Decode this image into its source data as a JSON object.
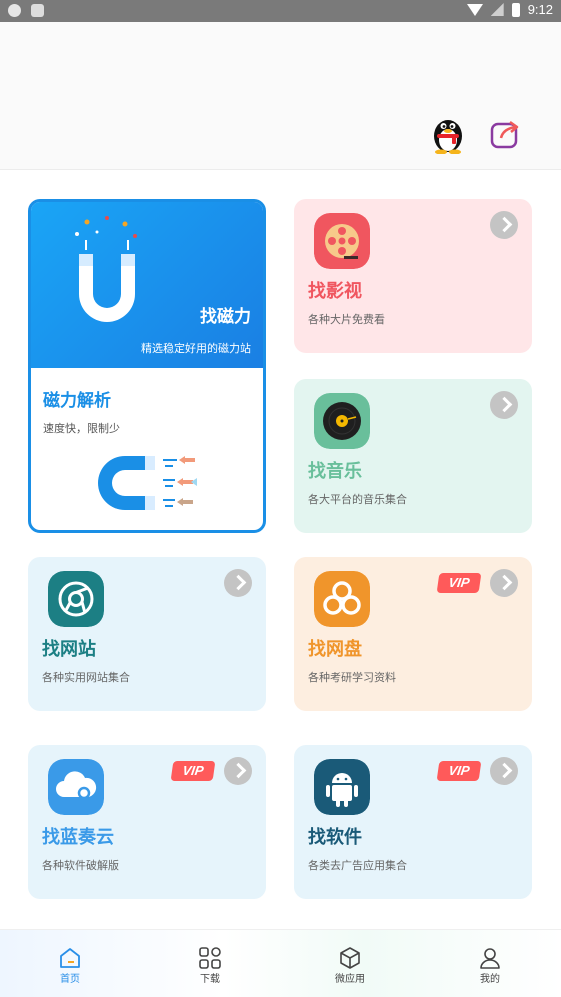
{
  "status_bar": {
    "time": "9:12"
  },
  "header": {
    "qq_icon": "qq-penguin-icon",
    "share_icon": "share-icon"
  },
  "magnet_card": {
    "top_title": "找磁力",
    "top_subtitle": "精选稳定好用的磁力站",
    "title": "磁力解析",
    "subtitle": "速度快，限制少",
    "accent": "#1a8fe6"
  },
  "cards": {
    "movies": {
      "title": "找影视",
      "subtitle": "各种大片免费看",
      "bg": "#ffe6e8",
      "title_color": "#f0565f",
      "icon": "film-reel-icon"
    },
    "music": {
      "title": "找音乐",
      "subtitle": "各大平台的音乐集合",
      "bg": "#e3f5f0",
      "title_color": "#69bf9b",
      "icon": "vinyl-record-icon"
    },
    "websites": {
      "title": "找网站",
      "subtitle": "各种实用网站集合",
      "bg": "#e6f4fb",
      "title_color": "#1c7f84",
      "icon": "browser-icon"
    },
    "netdisk": {
      "title": "找网盘",
      "subtitle": "各种考研学习资料",
      "bg": "#fdeee0",
      "title_color": "#f0952b",
      "icon": "cloud-disk-icon",
      "vip": "VIP"
    },
    "lanzou": {
      "title": "找蓝奏云",
      "subtitle": "各种软件破解版",
      "bg": "#e6f4fb",
      "title_color": "#3a9ae8",
      "icon": "cloud-icon",
      "vip": "VIP"
    },
    "software": {
      "title": "找软件",
      "subtitle": "各类去广告应用集合",
      "bg": "#e6f4fb",
      "title_color": "#1a5a78",
      "icon": "android-icon",
      "vip": "VIP"
    }
  },
  "bottom_nav": [
    {
      "label": "首页",
      "icon": "home-icon",
      "active": true
    },
    {
      "label": "下载",
      "icon": "grid-icon",
      "active": false
    },
    {
      "label": "微应用",
      "icon": "cube-icon",
      "active": false
    },
    {
      "label": "我的",
      "icon": "user-icon",
      "active": false
    }
  ]
}
